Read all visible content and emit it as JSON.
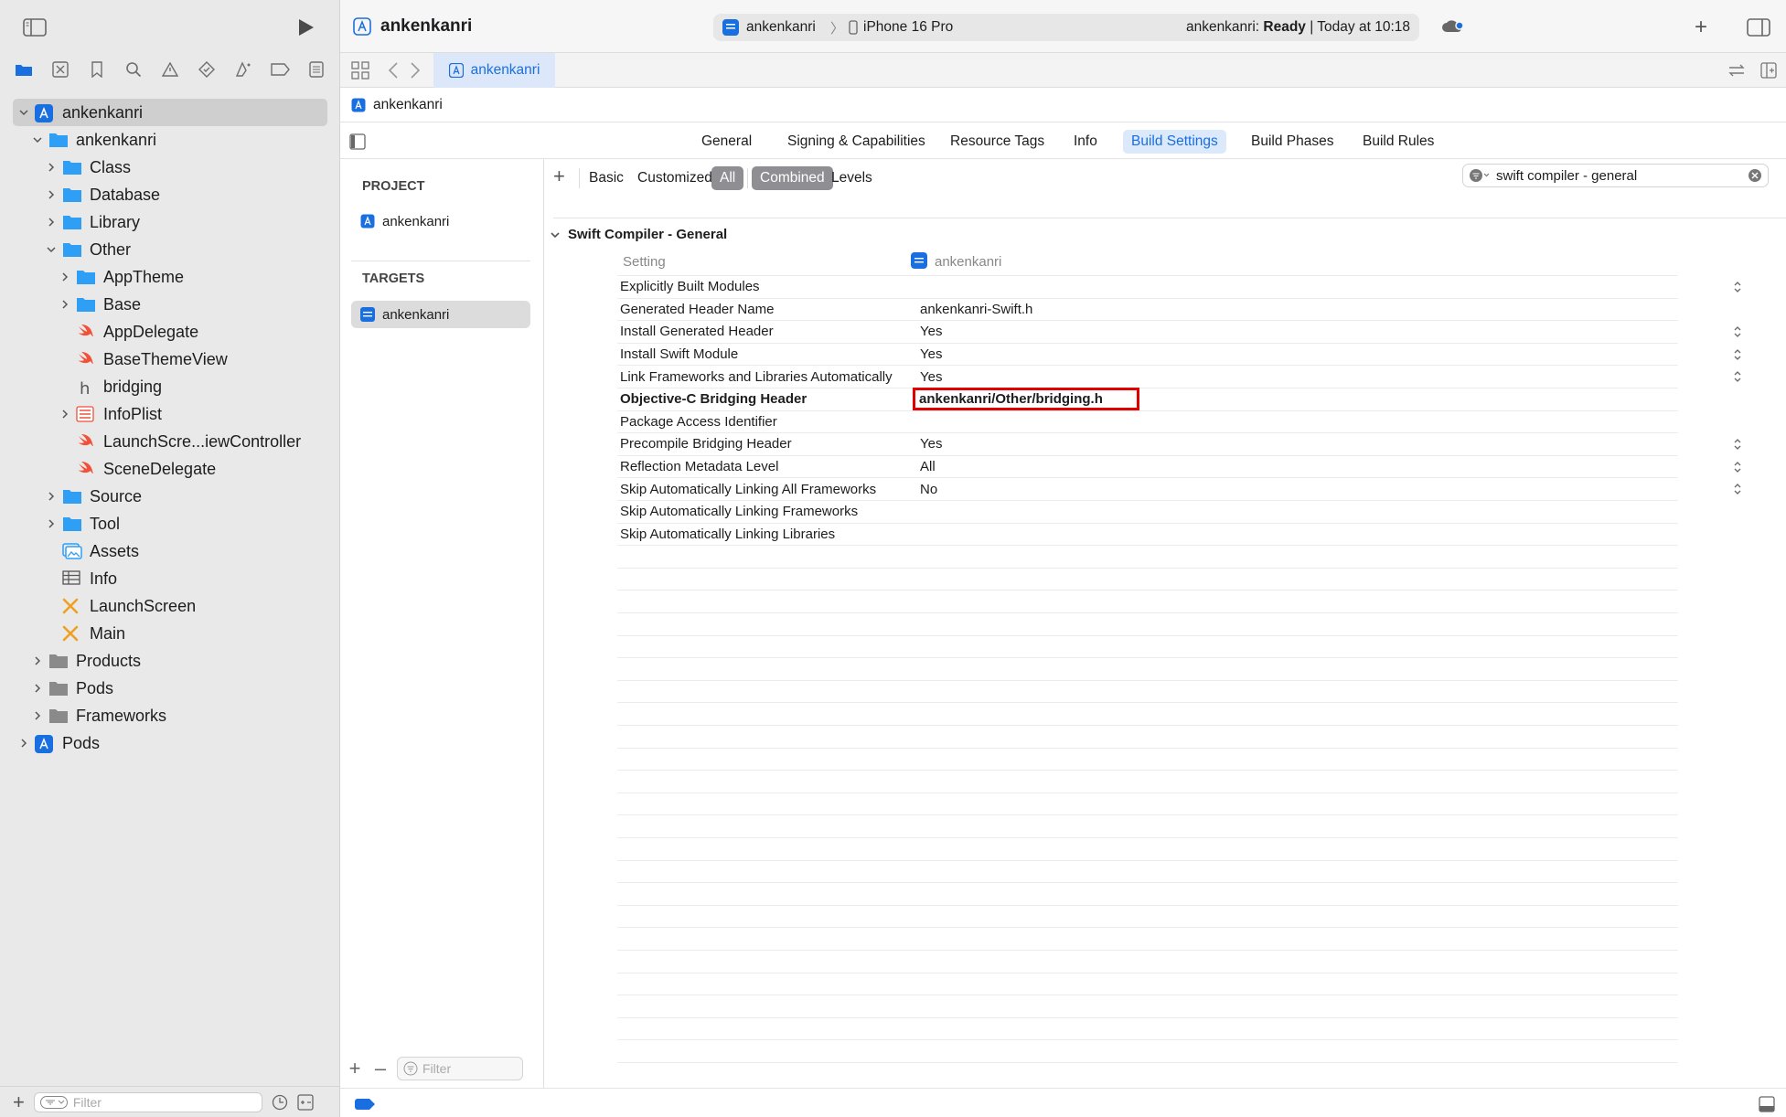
{
  "colors": {
    "accent": "#1a6fe0",
    "swift": "#f05138",
    "folder": "#2e9ff5",
    "gray_folder": "#8a8a8a",
    "highlight": "#e00000"
  },
  "toolbar": {
    "project_name": "ankenkanri",
    "scheme": "ankenkanri",
    "device": "iPhone 16 Pro",
    "status_project": "ankenkanri:",
    "status_state": "Ready",
    "status_time": "| Today at 10:18"
  },
  "navigator": {
    "tree": [
      {
        "label": "ankenkanri",
        "level": 0,
        "icon": "app-project-icon",
        "expanded": true,
        "selected": true
      },
      {
        "label": "ankenkanri",
        "level": 1,
        "icon": "folder-icon",
        "expanded": true
      },
      {
        "label": "Class",
        "level": 2,
        "icon": "folder-icon",
        "expanded": false
      },
      {
        "label": "Database",
        "level": 2,
        "icon": "folder-icon",
        "expanded": false
      },
      {
        "label": "Library",
        "level": 2,
        "icon": "folder-icon",
        "expanded": false
      },
      {
        "label": "Other",
        "level": 2,
        "icon": "folder-icon",
        "expanded": true
      },
      {
        "label": "AppTheme",
        "level": 3,
        "icon": "folder-icon",
        "expanded": false
      },
      {
        "label": "Base",
        "level": 3,
        "icon": "folder-icon",
        "expanded": false
      },
      {
        "label": "AppDelegate",
        "level": 3,
        "icon": "swift-file-icon"
      },
      {
        "label": "BaseThemeView",
        "level": 3,
        "icon": "swift-file-icon"
      },
      {
        "label": "bridging",
        "level": 3,
        "icon": "header-file-icon"
      },
      {
        "label": "InfoPlist",
        "level": 3,
        "icon": "plist-icon",
        "expanded": false
      },
      {
        "label": "LaunchScre...iewController",
        "level": 3,
        "icon": "swift-file-icon"
      },
      {
        "label": "SceneDelegate",
        "level": 3,
        "icon": "swift-file-icon"
      },
      {
        "label": "Source",
        "level": 2,
        "icon": "folder-icon",
        "expanded": false
      },
      {
        "label": "Tool",
        "level": 2,
        "icon": "folder-icon",
        "expanded": false
      },
      {
        "label": "Assets",
        "level": 2,
        "icon": "assets-icon"
      },
      {
        "label": "Info",
        "level": 2,
        "icon": "table-icon"
      },
      {
        "label": "LaunchScreen",
        "level": 2,
        "icon": "storyboard-icon"
      },
      {
        "label": "Main",
        "level": 2,
        "icon": "storyboard-icon"
      },
      {
        "label": "Products",
        "level": 1,
        "icon": "gray-folder-icon",
        "expanded": false
      },
      {
        "label": "Pods",
        "level": 1,
        "icon": "gray-folder-icon",
        "expanded": false
      },
      {
        "label": "Frameworks",
        "level": 1,
        "icon": "gray-folder-icon",
        "expanded": false
      },
      {
        "label": "Pods",
        "level": 0,
        "icon": "app-project-icon",
        "expanded": false
      }
    ],
    "filter_placeholder": "Filter"
  },
  "tabbar": {
    "active_tab": "ankenkanri"
  },
  "jumpbar": {
    "item": "ankenkanri"
  },
  "editor_tabs": [
    "General",
    "Signing & Capabilities",
    "Resource Tags",
    "Info",
    "Build Settings",
    "Build Phases",
    "Build Rules"
  ],
  "editor_active_tab": "Build Settings",
  "targets": {
    "project_header": "PROJECT",
    "project": "ankenkanri",
    "targets_header": "TARGETS",
    "target": "ankenkanri",
    "filter_placeholder": "Filter"
  },
  "settings_filters": {
    "basic": "Basic",
    "customized": "Customized",
    "all": "All",
    "combined": "Combined",
    "levels": "Levels",
    "search_value": "swift compiler - general"
  },
  "section": {
    "title": "Swift Compiler - General",
    "col_setting": "Setting",
    "col_target": "ankenkanri"
  },
  "rows": [
    {
      "key": "Explicitly Built Modules",
      "value": "",
      "stepper": true
    },
    {
      "key": "Generated Header Name",
      "value": "ankenkanri-Swift.h",
      "stepper": false
    },
    {
      "key": "Install Generated Header",
      "value": "Yes",
      "stepper": true
    },
    {
      "key": "Install Swift Module",
      "value": "Yes",
      "stepper": true
    },
    {
      "key": "Link Frameworks and Libraries Automatically",
      "value": "Yes",
      "stepper": true
    },
    {
      "key": "Objective-C Bridging Header",
      "value": "ankenkanri/Other/bridging.h",
      "stepper": false,
      "bold": true,
      "highlight": true
    },
    {
      "key": "Package Access Identifier",
      "value": "",
      "stepper": false
    },
    {
      "key": "Precompile Bridging Header",
      "value": "Yes",
      "stepper": true
    },
    {
      "key": "Reflection Metadata Level",
      "value": "All",
      "stepper": true
    },
    {
      "key": "Skip Automatically Linking All Frameworks",
      "value": "No",
      "stepper": true
    },
    {
      "key": "Skip Automatically Linking Frameworks",
      "value": "",
      "stepper": false
    },
    {
      "key": "Skip Automatically Linking Libraries",
      "value": "",
      "stepper": false
    }
  ]
}
